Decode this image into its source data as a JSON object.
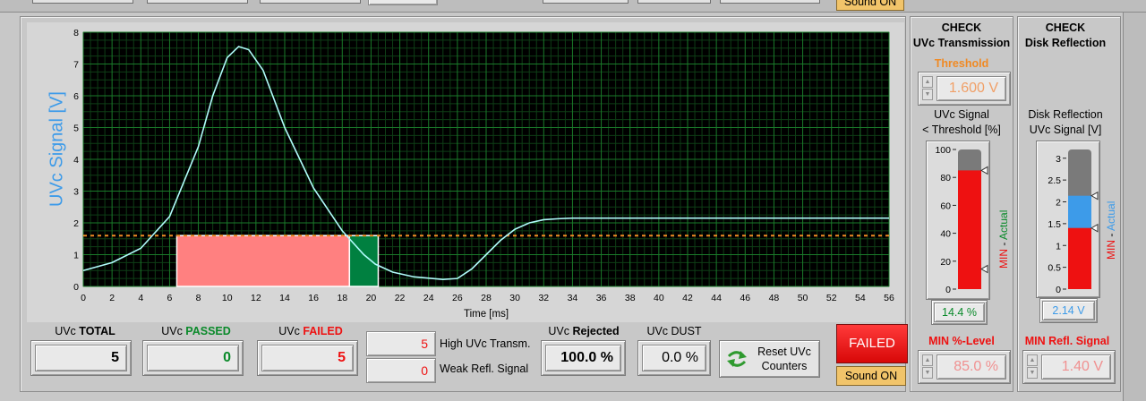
{
  "top_strip": {
    "sound_on_label": "Sound ON"
  },
  "chart": {
    "ylabel": "UVc Signal [V]",
    "xlabel": "Time [ms]",
    "x_ticks": [
      "0",
      "2",
      "4",
      "6",
      "8",
      "10",
      "12",
      "14",
      "16",
      "18",
      "20",
      "22",
      "24",
      "26",
      "28",
      "30",
      "32",
      "34",
      "36",
      "38",
      "40",
      "42",
      "44",
      "46",
      "48",
      "50",
      "52",
      "54",
      "56"
    ],
    "y_ticks": [
      "0",
      "1",
      "2",
      "3",
      "4",
      "5",
      "6",
      "7",
      "8"
    ]
  },
  "chart_data": {
    "type": "line",
    "xlabel": "Time [ms]",
    "ylabel": "UVc Signal [V]",
    "xlim": [
      0,
      56
    ],
    "ylim": [
      0,
      8
    ],
    "grid": true,
    "series": [
      {
        "x": [
          0,
          2,
          4,
          6,
          8,
          9,
          10,
          10.8,
          11.5,
          12.5,
          14,
          16,
          18,
          19.5,
          20.3,
          21.5,
          23,
          25,
          26,
          27,
          28,
          29,
          30,
          31,
          32,
          33,
          34,
          40,
          50,
          56
        ],
        "y": [
          0.5,
          0.75,
          1.2,
          2.2,
          4.4,
          6.0,
          7.2,
          7.55,
          7.45,
          6.8,
          5.0,
          3.1,
          1.75,
          1.0,
          0.7,
          0.45,
          0.3,
          0.22,
          0.25,
          0.55,
          1.0,
          1.45,
          1.8,
          2.0,
          2.1,
          2.13,
          2.15,
          2.15,
          2.15,
          2.15
        ]
      }
    ],
    "threshold_line": 1.6,
    "bands": [
      {
        "x": [
          6.5,
          18.5
        ],
        "y": [
          0,
          1.6
        ],
        "color": "#ff8080"
      },
      {
        "x": [
          18.5,
          20.5
        ],
        "y": [
          0,
          1.6
        ],
        "color": "#008040"
      }
    ]
  },
  "counters": {
    "total": {
      "label_prefix": "UVc ",
      "label_strong": "TOTAL",
      "value": "5"
    },
    "passed": {
      "label_prefix": "UVc ",
      "label_strong": "PASSED",
      "value": "0"
    },
    "failed": {
      "label_prefix": "UVc ",
      "label_strong": "FAILED",
      "value": "5"
    },
    "high_transm": {
      "value": "5",
      "label": "High UVc Transm."
    },
    "weak_refl": {
      "value": "0",
      "label": "Weak Refl. Signal"
    },
    "rejected": {
      "label_prefix": "UVc ",
      "label_strong": "Rejected",
      "value": "100.0 %"
    },
    "dust": {
      "label": "UVc DUST",
      "value": "0.0 %"
    },
    "reset_button": {
      "line1": "Reset UVc",
      "line2": "Counters"
    },
    "status": {
      "label": "FAILED",
      "color": "#ee1111"
    },
    "sound_on_label": "Sound ON"
  },
  "transmission": {
    "title1": "CHECK",
    "title2": "UVc Transmission",
    "threshold_label": "Threshold",
    "threshold_value": "1.600 V",
    "gauge_label1": "UVc Signal",
    "gauge_label2": "< Threshold [%]",
    "gauge_ticks": [
      "100",
      "80",
      "60",
      "40",
      "20",
      "0"
    ],
    "gauge_range": [
      0,
      100
    ],
    "gauge_actual": 85,
    "gauge_min": 14.4,
    "side_label_min": "MIN",
    "side_label_sep": " - ",
    "side_label_actual": "Actual",
    "actual_value": "14.4 %",
    "min_label": "MIN %-Level",
    "min_value": "85.0 %"
  },
  "reflection": {
    "title1": "CHECK",
    "title2": "Disk Reflection",
    "gauge_label1": "Disk Reflection",
    "gauge_label2": "UVc Signal [V]",
    "gauge_ticks": [
      "3",
      "2.5",
      "2",
      "1.5",
      "1",
      "0.5",
      "0"
    ],
    "gauge_range": [
      0,
      3.2
    ],
    "gauge_actual": 2.14,
    "gauge_min": 1.4,
    "side_label_min": "MIN",
    "side_label_sep": " - ",
    "side_label_actual": "Actual",
    "actual_value": "2.14 V",
    "min_label": "MIN Refl. Signal",
    "min_value": "1.40 V"
  },
  "colors": {
    "accent_blue": "#3d9be9",
    "red": "#ee1111",
    "green": "#0a8a2a",
    "orange": "#f08a24"
  }
}
